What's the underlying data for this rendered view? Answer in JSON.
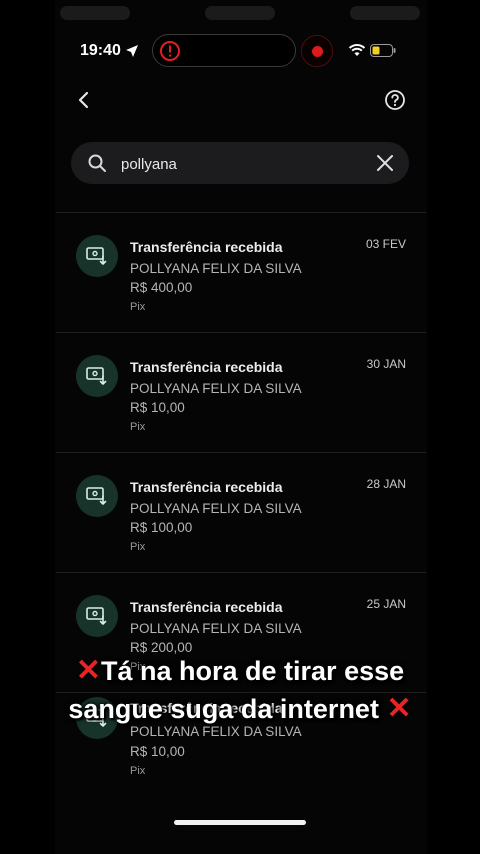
{
  "status_bar": {
    "time": "19:40"
  },
  "search": {
    "query": "pollyana",
    "placeholder": ""
  },
  "transactions": [
    {
      "title": "Transferência recebida",
      "name": "POLLYANA FELIX DA SILVA",
      "amount": "R$ 400,00",
      "method": "Pix",
      "date": "03 FEV"
    },
    {
      "title": "Transferência recebida",
      "name": "POLLYANA FELIX DA SILVA",
      "amount": "R$ 10,00",
      "method": "Pix",
      "date": "30 JAN"
    },
    {
      "title": "Transferência recebida",
      "name": "POLLYANA FELIX DA SILVA",
      "amount": "R$ 100,00",
      "method": "Pix",
      "date": "28 JAN"
    },
    {
      "title": "Transferência recebida",
      "name": "POLLYANA FELIX DA SILVA",
      "amount": "R$ 200,00",
      "method": "Pix",
      "date": "25 JAN"
    },
    {
      "title": "Transferência recebida",
      "name": "POLLYANA FELIX DA SILVA",
      "amount": "R$ 10,00",
      "method": "Pix",
      "date": ""
    }
  ],
  "caption": {
    "line1": "Tá na hora de tirar esse",
    "line2": "sangue suga da internet",
    "cross_symbol": "✕"
  },
  "colors": {
    "accent_icon_bg": "#17332a",
    "caption_cross": "#e82424",
    "record_dot": "#e01a1a"
  },
  "icons": {
    "back": "chevron-left-icon",
    "help": "help-circle-icon",
    "search": "search-icon",
    "clear": "close-icon",
    "transaction": "money-receive-icon"
  }
}
